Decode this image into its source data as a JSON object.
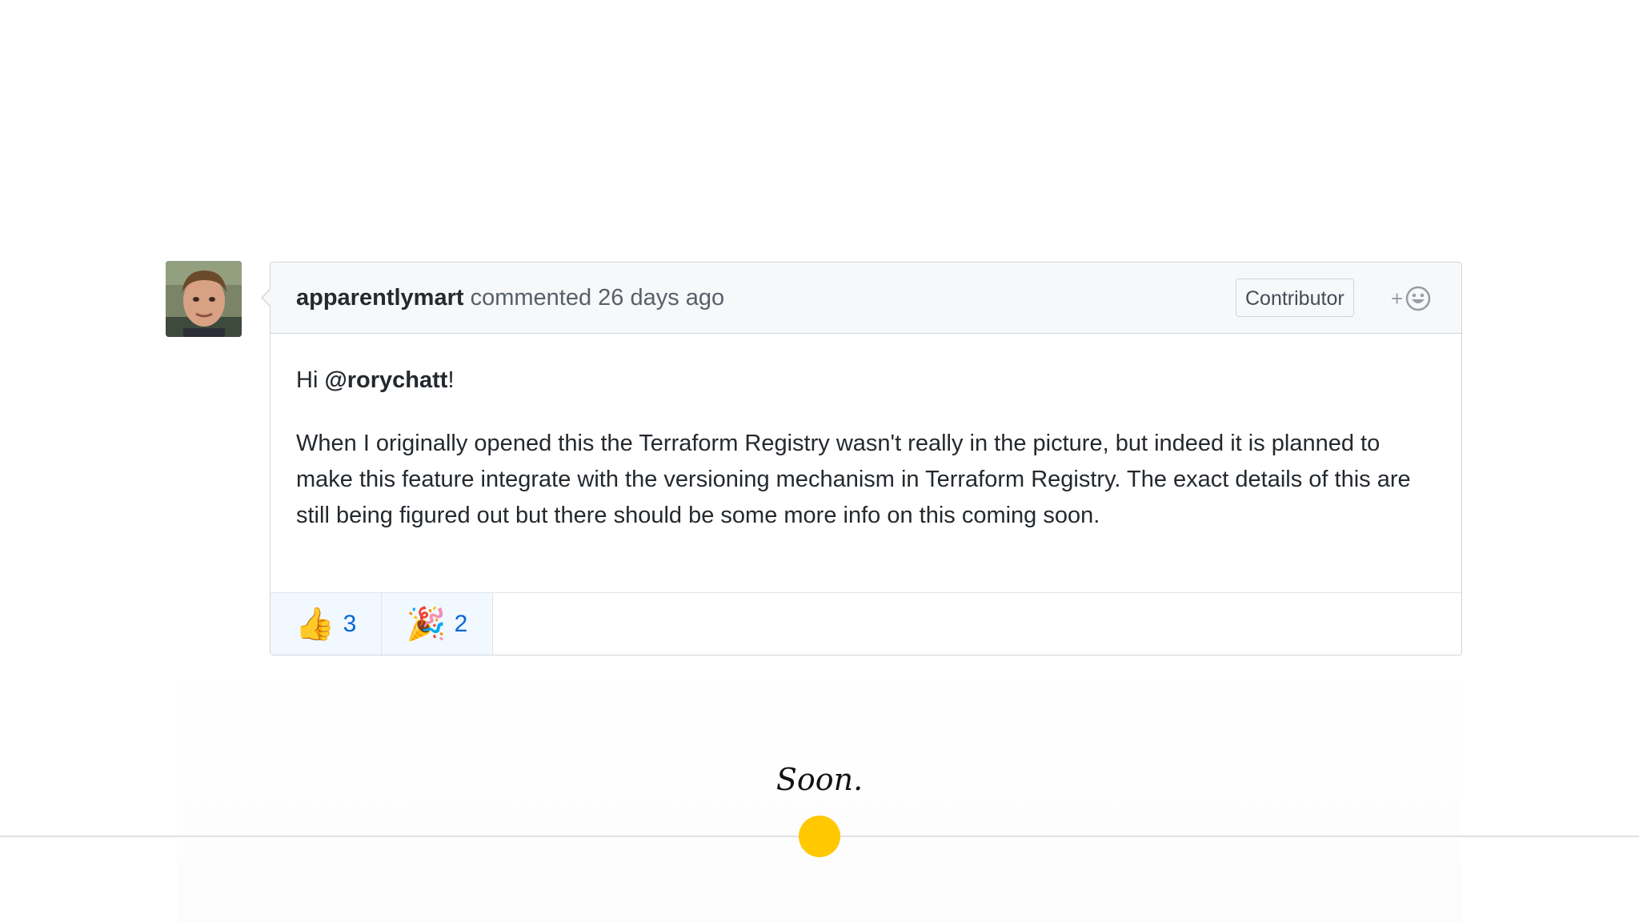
{
  "comment": {
    "author": "apparentlymart",
    "action": "commented",
    "time": "26 days ago",
    "badge": "Contributor",
    "add_reaction_symbol": "+",
    "greeting_prefix": "Hi ",
    "mention": "@rorychatt",
    "greeting_suffix": "!",
    "body": "When I originally opened this the Terraform Registry wasn't really in the picture, but indeed it is planned to make this feature integrate with the versioning mechanism in Terraform Registry. The exact details of this are still being figured out but there should be some more info on this coming soon.",
    "reactions": [
      {
        "icon": "thumbs-up-icon",
        "emoji": "👍",
        "count": "3"
      },
      {
        "icon": "party-popper-icon",
        "emoji": "🎉",
        "count": "2"
      }
    ]
  },
  "caption": "Soon.",
  "colors": {
    "accent_dot": "#ffc800",
    "link_blue": "#0366d6",
    "header_bg": "#f6f8fa",
    "reaction_bg": "#f1f8ff"
  }
}
